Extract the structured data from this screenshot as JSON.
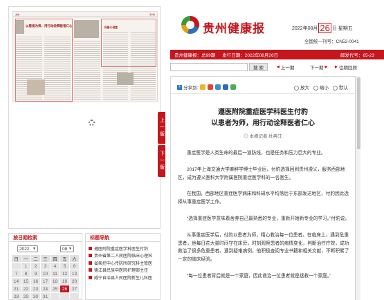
{
  "header": {
    "logo_text": "贵州健康报",
    "date_prefix": "2022年08月",
    "date_day": "26",
    "date_suffix": "日 星期五",
    "cn_number": "全国统一刊号：CN52-0041"
  },
  "info_bar": {
    "paper": "贵州健康报：",
    "issue": "总99期",
    "issue_date_label": "发行日期：",
    "issue_date": "2022年08月26日",
    "postal_code": "邮发代号：65-23"
  },
  "toolbar": {
    "search_placeholder": "",
    "search_button": "搜 索",
    "prev_issue": "上一期",
    "next_issue": "下一期",
    "archive": "往期回顾"
  },
  "side_tabs": {
    "prev_page": "上一版",
    "next_page": "下一版"
  },
  "paper_thumb": {
    "header_left": "主编",
    "header_right": "第7版",
    "headline_left": "以患者为师，用行动诠释医者仁心",
    "headline_right": "科普小讲堂",
    "colors": {
      "accent": "#c4161c",
      "highlight_box": "#e07a7a"
    }
  },
  "share": {
    "label": "分享到:",
    "icons": [
      "qzone-icon",
      "weibo-icon",
      "tencent-weibo-icon",
      "renren-icon",
      "wechat-icon"
    ]
  },
  "zoom": {
    "enlarge": "放大",
    "shrink": "缩小",
    "default": "默认"
  },
  "article": {
    "title_line1": "遵医附院重症医学科医生付豹",
    "title_line2": "以患者为师，用行动诠释医者仁心",
    "author": "◎ 本报记者 杜冉江",
    "paragraphs": [
      "重症医学是人类生命的最后一道防线，也是任务和压力巨大的专业。",
      "2017年上海交通大学麻醉学博士毕业后，付豹选择回到贵州遵义，服务西部地区，成为遵义医科大学附属医院重症医学科的一名医生。",
      "在我国，西部地区重症医学病床和科研水平均落后于东部发达地区，付豹因此选择从事重症医学工作。",
      "“选择重症医学意味着舍弃自己最熟悉的专业，重新开始新专业的学习。”付豹说。",
      "从事重症医学后，付豹以患者为师，精心救治每一位患者。在临床上，遇到危重患者，他每日花大量时间守在床旁，时刻观察患者的病情变化，判断治疗疗效，成功救治了很多危重患者。遇到疑难病例，他积极查阅专业书籍和相关文献，不断积累了一定的临床经验。",
      "“每一位患者背后就是一个家庭，因此救治一位患者就是拯救一个家庭。”"
    ]
  },
  "date_search": {
    "title": "按日期检索",
    "year": "2022",
    "month": "08",
    "weekdays": [
      "日",
      "一",
      "二",
      "三",
      "四",
      "五",
      "六"
    ],
    "rows": [
      [
        "",
        "1",
        "2",
        "3",
        "4",
        "5",
        "6"
      ],
      [
        "7",
        "8",
        "9",
        "10",
        "11",
        "12",
        "13"
      ],
      [
        "14",
        "15",
        "16",
        "17",
        "18",
        "19",
        "20"
      ],
      [
        "21",
        "22",
        "23",
        "24",
        "25",
        "26",
        "27"
      ],
      [
        "28",
        "29",
        "30",
        "31",
        "",
        "",
        ""
      ]
    ],
    "selected_day": "26"
  },
  "title_nav": {
    "title": "标题导航",
    "items": [
      "遵医附院重症医学科医生付豹",
      "贵州省第二人民医院临床心理科",
      "省疾控中心传防所研究科主管医",
      "德江县民族中医院护理部主任",
      "威宁自治县人民医院新生儿科医"
    ]
  }
}
